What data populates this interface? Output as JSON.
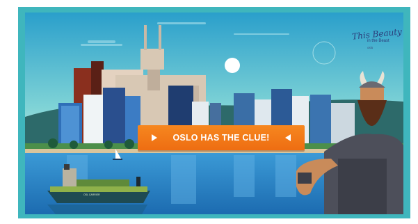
{
  "banner": {
    "cta_label": "OSLO HAS THE CLUE!",
    "logo": {
      "line1": "This Beauty",
      "line2": "in the Beast",
      "line3": "oslo"
    },
    "ship_name": "OSL CARRIER"
  },
  "colors": {
    "frame": "#3fb6bd",
    "sky_top": "#2a9fcb",
    "sky_bottom": "#a8e7e0",
    "water": "#2a86c9",
    "cta": "#f27a1a"
  },
  "icons": {
    "cta_left": "play-triangle-icon",
    "cta_right": "play-triangle-reversed-icon",
    "sun": "sun-icon"
  }
}
